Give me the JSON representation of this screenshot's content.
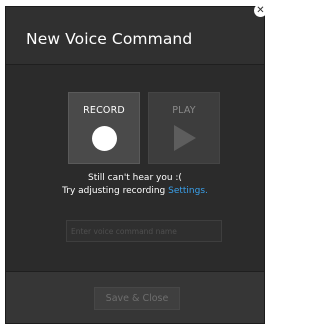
{
  "dialog": {
    "title": "New Voice Command",
    "close_icon": "close-icon"
  },
  "record": {
    "label": "RECORD",
    "icon": "record-dot-icon"
  },
  "play": {
    "label": "PLAY",
    "icon": "play-icon"
  },
  "status": {
    "line1": "Still can't hear you :(",
    "line2_prefix": "Try adjusting recording ",
    "settings_link": "Settings."
  },
  "name_input": {
    "placeholder": "Enter voice command name",
    "value": ""
  },
  "footer": {
    "save_label": "Save & Close"
  },
  "colors": {
    "dialog_bg": "#2b2b2b",
    "link": "#3aa0ea",
    "text": "#ffffff"
  }
}
